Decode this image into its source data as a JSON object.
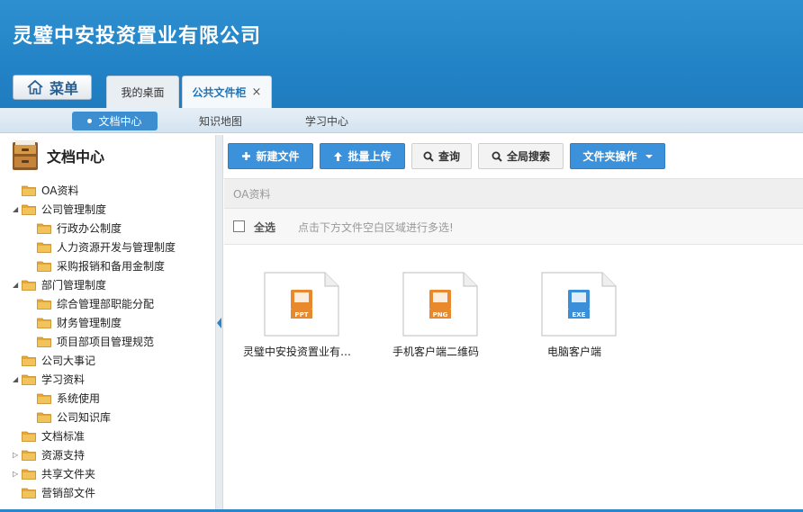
{
  "header": {
    "company": "灵璧中安投资置业有限公司",
    "menu_label": "菜单",
    "tabs": [
      {
        "label": "我的桌面"
      },
      {
        "label": "公共文件柜",
        "close": "×"
      }
    ]
  },
  "subnav": [
    "文档中心",
    "知识地图",
    "学习中心"
  ],
  "sidebar": {
    "title": "文档中心",
    "tree": [
      {
        "label": "OA资料",
        "arrow": ""
      },
      {
        "label": "公司管理制度",
        "arrow": "◢"
      },
      {
        "label": "行政办公制度",
        "arrow": ""
      },
      {
        "label": "人力资源开发与管理制度",
        "arrow": ""
      },
      {
        "label": "采购报销和备用金制度",
        "arrow": ""
      },
      {
        "label": "部门管理制度",
        "arrow": "◢"
      },
      {
        "label": "综合管理部职能分配",
        "arrow": ""
      },
      {
        "label": "财务管理制度",
        "arrow": ""
      },
      {
        "label": "项目部项目管理规范",
        "arrow": ""
      },
      {
        "label": "公司大事记",
        "arrow": ""
      },
      {
        "label": "学习资料",
        "arrow": "◢"
      },
      {
        "label": "系统使用",
        "arrow": ""
      },
      {
        "label": "公司知识库",
        "arrow": ""
      },
      {
        "label": "文档标准",
        "arrow": ""
      },
      {
        "label": "资源支持",
        "arrow": "▷"
      },
      {
        "label": "共享文件夹",
        "arrow": "▷"
      },
      {
        "label": "营销部文件",
        "arrow": ""
      }
    ]
  },
  "toolbar": {
    "new_file": "新建文件",
    "batch_upload": "批量上传",
    "query": "查询",
    "global_search": "全局搜索",
    "folder_ops": "文件夹操作"
  },
  "path": "OA资料",
  "select": {
    "all": "全选",
    "hint": "点击下方文件空白区域进行多选!"
  },
  "files": [
    {
      "name": "灵璧中安投资置业有…",
      "type": "PPT",
      "color": "#e8892d"
    },
    {
      "name": "手机客户端二维码",
      "type": "PNG",
      "color": "#e8892d"
    },
    {
      "name": "电脑客户端",
      "type": "EXE",
      "color": "#3a8fd8"
    }
  ]
}
